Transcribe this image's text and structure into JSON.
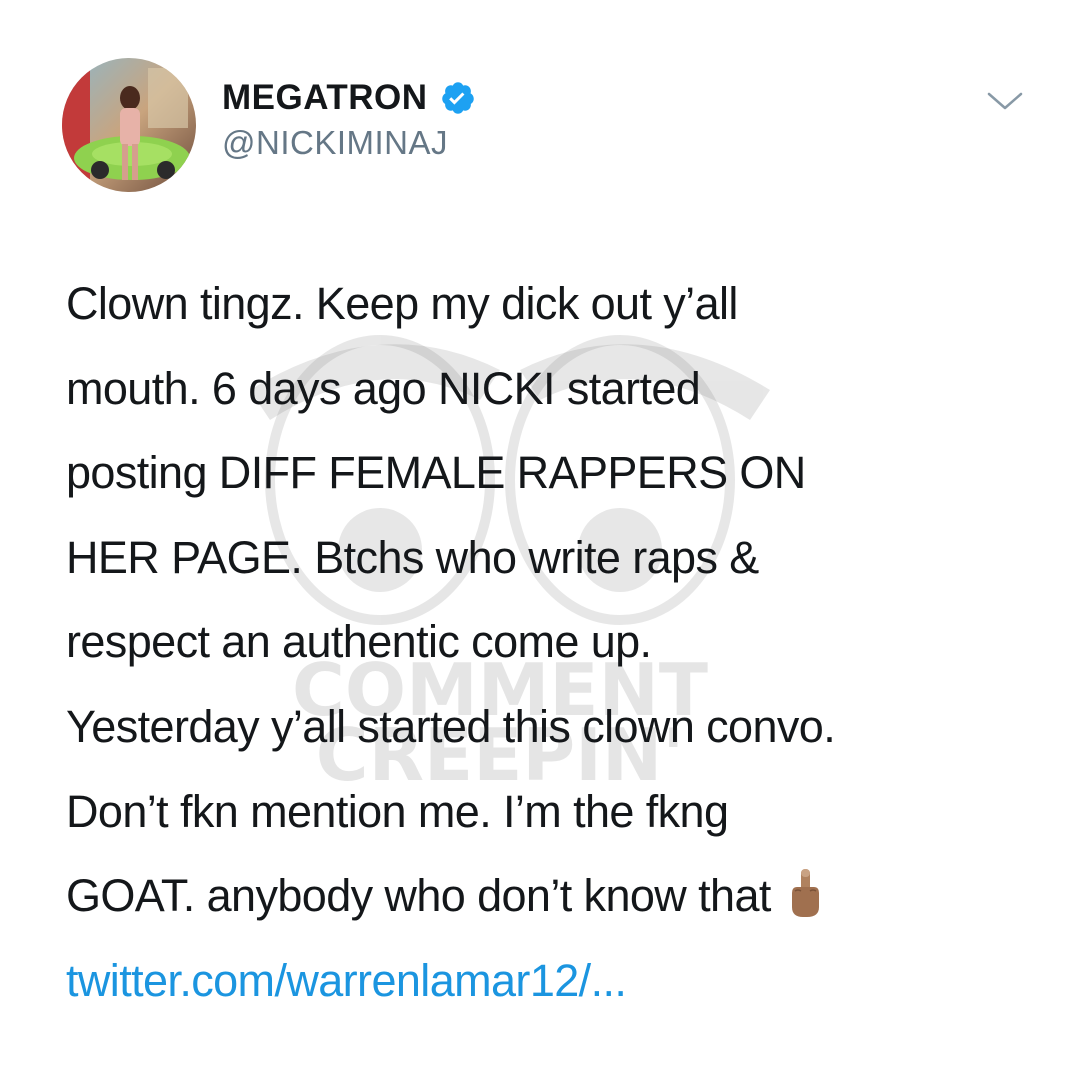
{
  "tweet": {
    "author": {
      "display_name": "MEGATRON",
      "handle": "@NICKIMINAJ",
      "avatar_icon": "profile-photo-avatar",
      "verified_icon": "verified-badge-icon"
    },
    "menu_icon": "chevron-down-icon",
    "body_lines": [
      "Clown tingz. Keep my dick out y’all",
      "mouth. 6 days ago NICKI started",
      "posting DIFF FEMALE RAPPERS ON",
      "HER PAGE. Btchs who write raps &",
      "respect an authentic come up.",
      "Yesterday y’all started this clown convo.",
      "Don’t fkn mention me. I’m the fkng",
      "GOAT. anybody who don’t know that"
    ],
    "emoji_icon": "middle-finger-emoji-icon",
    "link_text": "twitter.com/warrenlamar12/...",
    "colors": {
      "link": "#1b95e0",
      "verified": "#1da1f2",
      "handle": "#657786",
      "text": "#14171a"
    }
  },
  "watermark": {
    "line1": "COMMENT",
    "line2": "CREEPIN'"
  }
}
